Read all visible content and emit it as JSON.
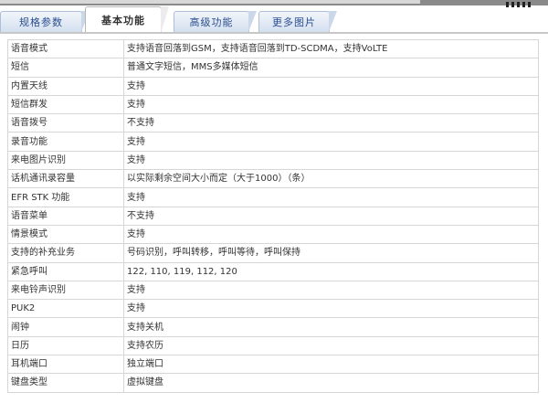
{
  "tabs": [
    {
      "label": "规格参数",
      "active": false
    },
    {
      "label": "基本功能",
      "active": true
    },
    {
      "label": "高级功能",
      "active": false
    },
    {
      "label": "更多图片",
      "active": false
    }
  ],
  "specs": [
    {
      "key": "语音模式",
      "value": "支持语音回落到GSM，支持语音回落到TD-SCDMA，支持VoLTE"
    },
    {
      "key": "短信",
      "value": "普通文字短信，MMS多媒体短信"
    },
    {
      "key": "内置天线",
      "value": "支持"
    },
    {
      "key": "短信群发",
      "value": "支持"
    },
    {
      "key": "语音拨号",
      "value": "不支持"
    },
    {
      "key": "录音功能",
      "value": "支持"
    },
    {
      "key": "来电图片识别",
      "value": "支持"
    },
    {
      "key": "话机通讯录容量",
      "value": "以实际剩余空间大小而定（大于1000）（条）"
    },
    {
      "key": "EFR STK 功能",
      "value": "支持"
    },
    {
      "key": "语音菜单",
      "value": "不支持"
    },
    {
      "key": "情景模式",
      "value": "支持"
    },
    {
      "key": "支持的补充业务",
      "value": "号码识别，呼叫转移，呼叫等待，呼叫保持"
    },
    {
      "key": "紧急呼叫",
      "value": "122, 110, 119, 112, 120"
    },
    {
      "key": "来电铃声识别",
      "value": "支持"
    },
    {
      "key": "PUK2",
      "value": "支持"
    },
    {
      "key": "闹钟",
      "value": "支持关机"
    },
    {
      "key": "日历",
      "value": "支持农历"
    },
    {
      "key": "耳机端口",
      "value": "独立端口"
    },
    {
      "key": "键盘类型",
      "value": "虚拟键盘"
    }
  ]
}
